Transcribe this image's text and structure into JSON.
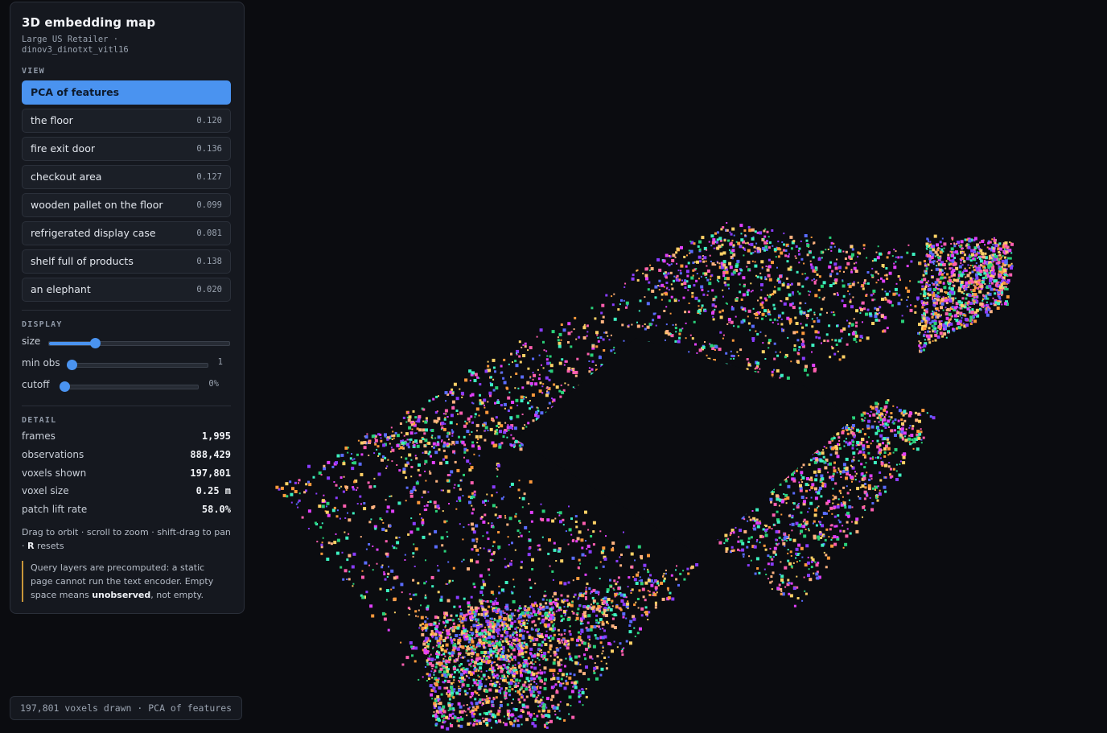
{
  "app": {
    "title": "3D embedding map",
    "subtitle": "Large US Retailer · dinov3_dinotxt_vitl16"
  },
  "view": {
    "heading": "VIEW",
    "items": [
      {
        "label": "PCA of features",
        "score": "",
        "active": true
      },
      {
        "label": "the floor",
        "score": "0.120"
      },
      {
        "label": "fire exit door",
        "score": "0.136"
      },
      {
        "label": "checkout area",
        "score": "0.127"
      },
      {
        "label": "wooden pallet on the floor",
        "score": "0.099"
      },
      {
        "label": "refrigerated display case",
        "score": "0.081"
      },
      {
        "label": "shelf full of products",
        "score": "0.138"
      },
      {
        "label": "an elephant",
        "score": "0.020"
      }
    ]
  },
  "display": {
    "heading": "DISPLAY",
    "size": {
      "label": "size",
      "fraction": 0.26
    },
    "min_obs": {
      "label": "min obs",
      "value": "1",
      "fraction": 0.0
    },
    "cutoff": {
      "label": "cutoff",
      "value": "0%",
      "fraction": 0.0
    }
  },
  "detail": {
    "heading": "DETAIL",
    "rows": [
      {
        "label": "frames",
        "value": "1,995"
      },
      {
        "label": "observations",
        "value": "888,429"
      },
      {
        "label": "voxels shown",
        "value": "197,801"
      },
      {
        "label": "voxel size",
        "value": "0.25 m"
      },
      {
        "label": "patch lift rate",
        "value": "58.0%"
      }
    ],
    "help_prefix": "Drag to orbit · scroll to zoom · shift-drag to pan · ",
    "help_key": "R",
    "help_suffix": " resets",
    "note_prefix": "Query layers are precomputed: a static page cannot run the text encoder. Empty space means ",
    "note_bold": "unobserved",
    "note_suffix": ", not empty."
  },
  "status": {
    "text": "197,801 voxels drawn · PCA of features"
  },
  "colors": {
    "accent": "#4a93f0",
    "note_border": "#c9963a",
    "background": "#0b0c10",
    "voxel_palette": [
      "#ff9a3c",
      "#ffd166",
      "#ff5fb0",
      "#8a3dff",
      "#3df0c0",
      "#2ad17a",
      "#5a6cff",
      "#ffb380",
      "#e040fb"
    ]
  }
}
